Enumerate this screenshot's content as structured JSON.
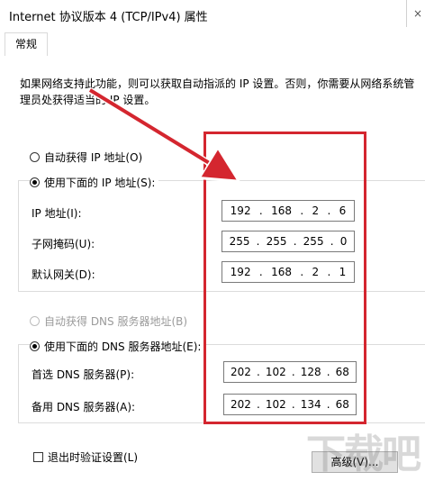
{
  "window": {
    "title": "Internet 协议版本 4 (TCP/IPv4) 属性",
    "close_glyph": "×"
  },
  "tabs": [
    {
      "label": "常规"
    }
  ],
  "description": "如果网络支持此功能，则可以获取自动指派的 IP 设置。否则，你需要从网络系统管理员处获得适当的 IP 设置。",
  "ip_section": {
    "auto_label": "自动获得 IP 地址(O)",
    "manual_label": "使用下面的 IP 地址(S):",
    "fields": [
      {
        "label": "IP 地址(I):",
        "octets": [
          "192",
          "168",
          "2",
          "6"
        ]
      },
      {
        "label": "子网掩码(U):",
        "octets": [
          "255",
          "255",
          "255",
          "0"
        ]
      },
      {
        "label": "默认网关(D):",
        "octets": [
          "192",
          "168",
          "2",
          "1"
        ]
      }
    ]
  },
  "dns_section": {
    "auto_label": "自动获得 DNS 服务器地址(B)",
    "manual_label": "使用下面的 DNS 服务器地址(E):",
    "fields": [
      {
        "label": "首选 DNS 服务器(P):",
        "octets": [
          "202",
          "102",
          "128",
          "68"
        ]
      },
      {
        "label": "备用 DNS 服务器(A):",
        "octets": [
          "202",
          "102",
          "134",
          "68"
        ]
      }
    ]
  },
  "footer": {
    "validate_label": "退出时验证设置(L)",
    "advanced_label": "高级(V)..."
  },
  "watermark": "下载吧",
  "colors": {
    "highlight": "#d4262f"
  }
}
